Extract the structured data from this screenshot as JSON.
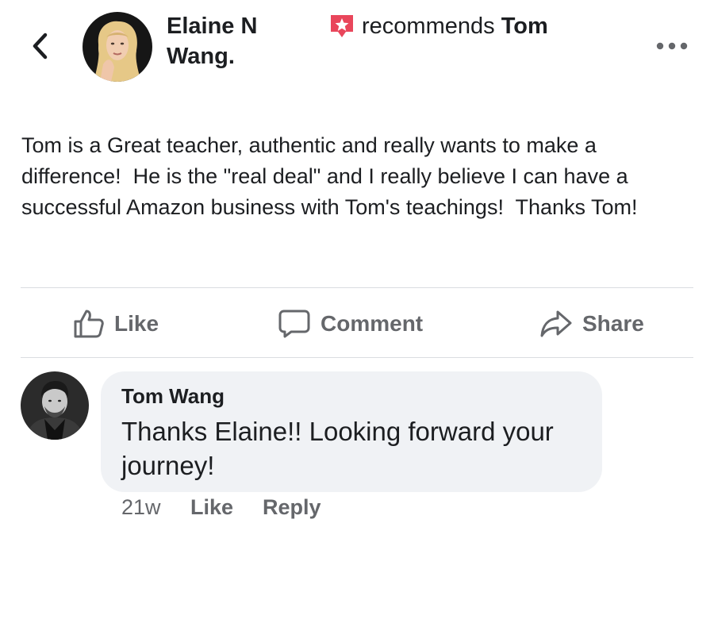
{
  "header": {
    "poster_first": "Elaine N",
    "poster_last": "Wang.",
    "recommends_verb": "recommends",
    "recommends_target": "Tom",
    "recommend_icon_color": "#e9465b"
  },
  "post": {
    "text": "Tom is a Great teacher, authentic and really wants to make a difference!  He is the \"real deal\" and I really believe I can have a successful Amazon business with Tom's teachings!  Thanks Tom!"
  },
  "actions": {
    "like": "Like",
    "comment": "Comment",
    "share": "Share"
  },
  "comment": {
    "author": "Tom Wang",
    "text": "Thanks Elaine!! Looking forward your journey!",
    "time": "21w",
    "like_label": "Like",
    "reply_label": "Reply"
  },
  "icons": {
    "back": "chevron-left-icon",
    "more": "more-dots-icon",
    "recommend": "recommendation-star-icon",
    "like": "thumbs-up-icon",
    "comment": "comment-bubble-icon",
    "share": "share-arrow-icon"
  }
}
